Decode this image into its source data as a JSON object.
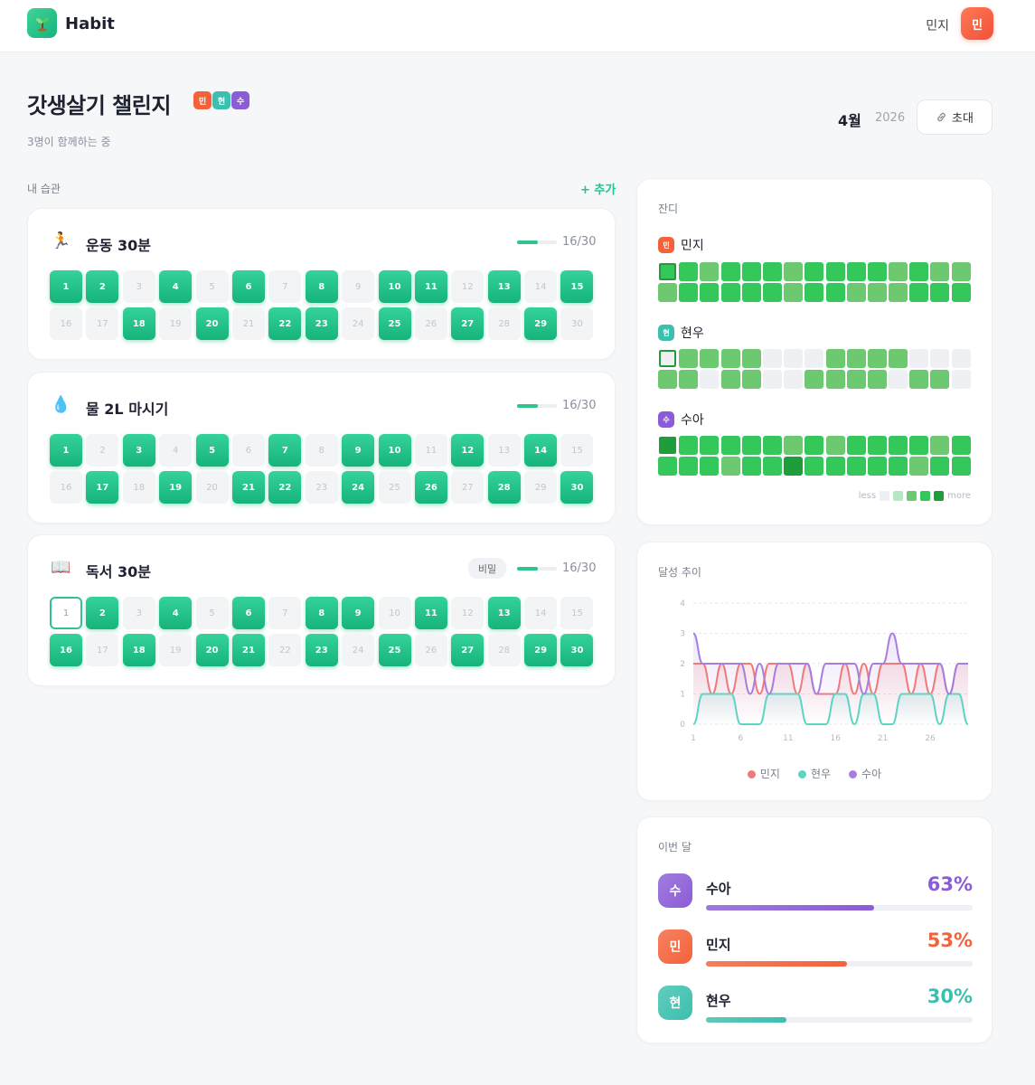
{
  "app": {
    "name": "Habit",
    "user_name": "민지",
    "user_initial": "민"
  },
  "challenge": {
    "title": "갓생살기 챌린지",
    "members": [
      {
        "initial": "민",
        "color": "#f4623a"
      },
      {
        "initial": "현",
        "color": "#3cbfae"
      },
      {
        "initial": "수",
        "color": "#8b5cd6"
      }
    ],
    "subtitle": "3명이 함께하는 중",
    "month": "4월",
    "year": "2026",
    "invite_label": "초대"
  },
  "habits_section": {
    "label": "내 습관",
    "add_label": "+ 추가"
  },
  "habits": [
    {
      "icon": "🏃",
      "icon_name": "running-icon",
      "name": "운동 30분",
      "tag": "",
      "count": "16/30",
      "progress": 0.53,
      "done": [
        1,
        2,
        4,
        6,
        8,
        10,
        11,
        13,
        15,
        18,
        20,
        22,
        23,
        25,
        27,
        29
      ],
      "today": null
    },
    {
      "icon": "💧",
      "icon_name": "water-drop-icon",
      "name": "물 2L 마시기",
      "tag": "",
      "count": "16/30",
      "progress": 0.53,
      "done": [
        1,
        3,
        5,
        7,
        9,
        10,
        12,
        14,
        17,
        19,
        21,
        22,
        24,
        26,
        28,
        30
      ],
      "today": null
    },
    {
      "icon": "📖",
      "icon_name": "book-icon",
      "name": "독서 30분",
      "tag": "비밀",
      "count": "16/30",
      "progress": 0.53,
      "done": [
        2,
        4,
        6,
        8,
        9,
        11,
        13,
        16,
        18,
        20,
        21,
        23,
        25,
        27,
        29,
        30
      ],
      "today": 1
    }
  ],
  "grass": {
    "title": "잔디",
    "people": [
      {
        "name": "민지",
        "initial": "민",
        "color": "#f4623a",
        "levels": [
          3,
          3,
          2,
          3,
          3,
          3,
          2,
          3,
          3,
          3,
          3,
          2,
          3,
          2,
          2,
          2,
          3,
          3,
          3,
          3,
          3,
          2,
          3,
          3,
          2,
          2,
          2,
          3,
          3,
          3
        ]
      },
      {
        "name": "현우",
        "initial": "현",
        "color": "#3cbfae",
        "levels": [
          0,
          2,
          2,
          2,
          2,
          0,
          0,
          0,
          2,
          2,
          2,
          2,
          0,
          0,
          0,
          2,
          2,
          0,
          2,
          2,
          0,
          0,
          2,
          2,
          2,
          2,
          0,
          2,
          2,
          0
        ]
      },
      {
        "name": "수아",
        "initial": "수",
        "color": "#8b5cd6",
        "levels": [
          4,
          3,
          3,
          3,
          3,
          3,
          2,
          3,
          2,
          3,
          3,
          3,
          3,
          2,
          3,
          3,
          3,
          3,
          2,
          3,
          3,
          4,
          3,
          3,
          3,
          3,
          3,
          2,
          3,
          3
        ]
      }
    ],
    "legend_less": "less",
    "legend_more": "more"
  },
  "trend": {
    "title": "달성 추이",
    "legend": [
      {
        "name": "민지",
        "color": "#f07a7a"
      },
      {
        "name": "현우",
        "color": "#5fd3c4"
      },
      {
        "name": "수아",
        "color": "#a77ee0"
      }
    ]
  },
  "chart_data": {
    "type": "line",
    "x": [
      1,
      2,
      3,
      4,
      5,
      6,
      7,
      8,
      9,
      10,
      11,
      12,
      13,
      14,
      15,
      16,
      17,
      18,
      19,
      20,
      21,
      22,
      23,
      24,
      25,
      26,
      27,
      28,
      29,
      30
    ],
    "x_ticks": [
      1,
      6,
      11,
      16,
      21,
      26
    ],
    "ylim": [
      0,
      4
    ],
    "y_ticks": [
      0,
      1,
      2,
      3,
      4
    ],
    "series": [
      {
        "name": "민지",
        "color": "#f07a7a",
        "values": [
          2,
          2,
          1,
          2,
          1,
          2,
          2,
          1,
          2,
          2,
          2,
          1,
          2,
          1,
          1,
          1,
          2,
          1,
          2,
          1,
          2,
          2,
          2,
          1,
          2,
          1,
          2,
          1,
          2,
          2
        ]
      },
      {
        "name": "현우",
        "color": "#5fd3c4",
        "values": [
          0,
          1,
          1,
          1,
          1,
          0,
          0,
          0,
          1,
          1,
          1,
          1,
          0,
          0,
          0,
          1,
          1,
          0,
          1,
          1,
          0,
          0,
          1,
          1,
          1,
          1,
          0,
          1,
          1,
          0
        ]
      },
      {
        "name": "수아",
        "color": "#a77ee0",
        "values": [
          3,
          2,
          2,
          2,
          2,
          2,
          1,
          2,
          1,
          2,
          2,
          2,
          2,
          1,
          2,
          2,
          2,
          2,
          1,
          2,
          2,
          3,
          2,
          2,
          2,
          2,
          2,
          1,
          2,
          2
        ]
      }
    ],
    "grid": "horizontal-dashed",
    "legend_position": "bottom"
  },
  "ranking": {
    "title": "이번 달",
    "rows": [
      {
        "name": "수아",
        "initial": "수",
        "pct_label": "63%",
        "pct": 63,
        "color": "#8b5cd6",
        "bar": "#8b5cd6"
      },
      {
        "name": "민지",
        "initial": "민",
        "pct_label": "53%",
        "pct": 53,
        "color": "#f4623a",
        "bar": "#f4623a"
      },
      {
        "name": "현우",
        "initial": "현",
        "pct_label": "30%",
        "pct": 30,
        "color": "#3cbfae",
        "bar": "#3cbfae"
      }
    ]
  }
}
